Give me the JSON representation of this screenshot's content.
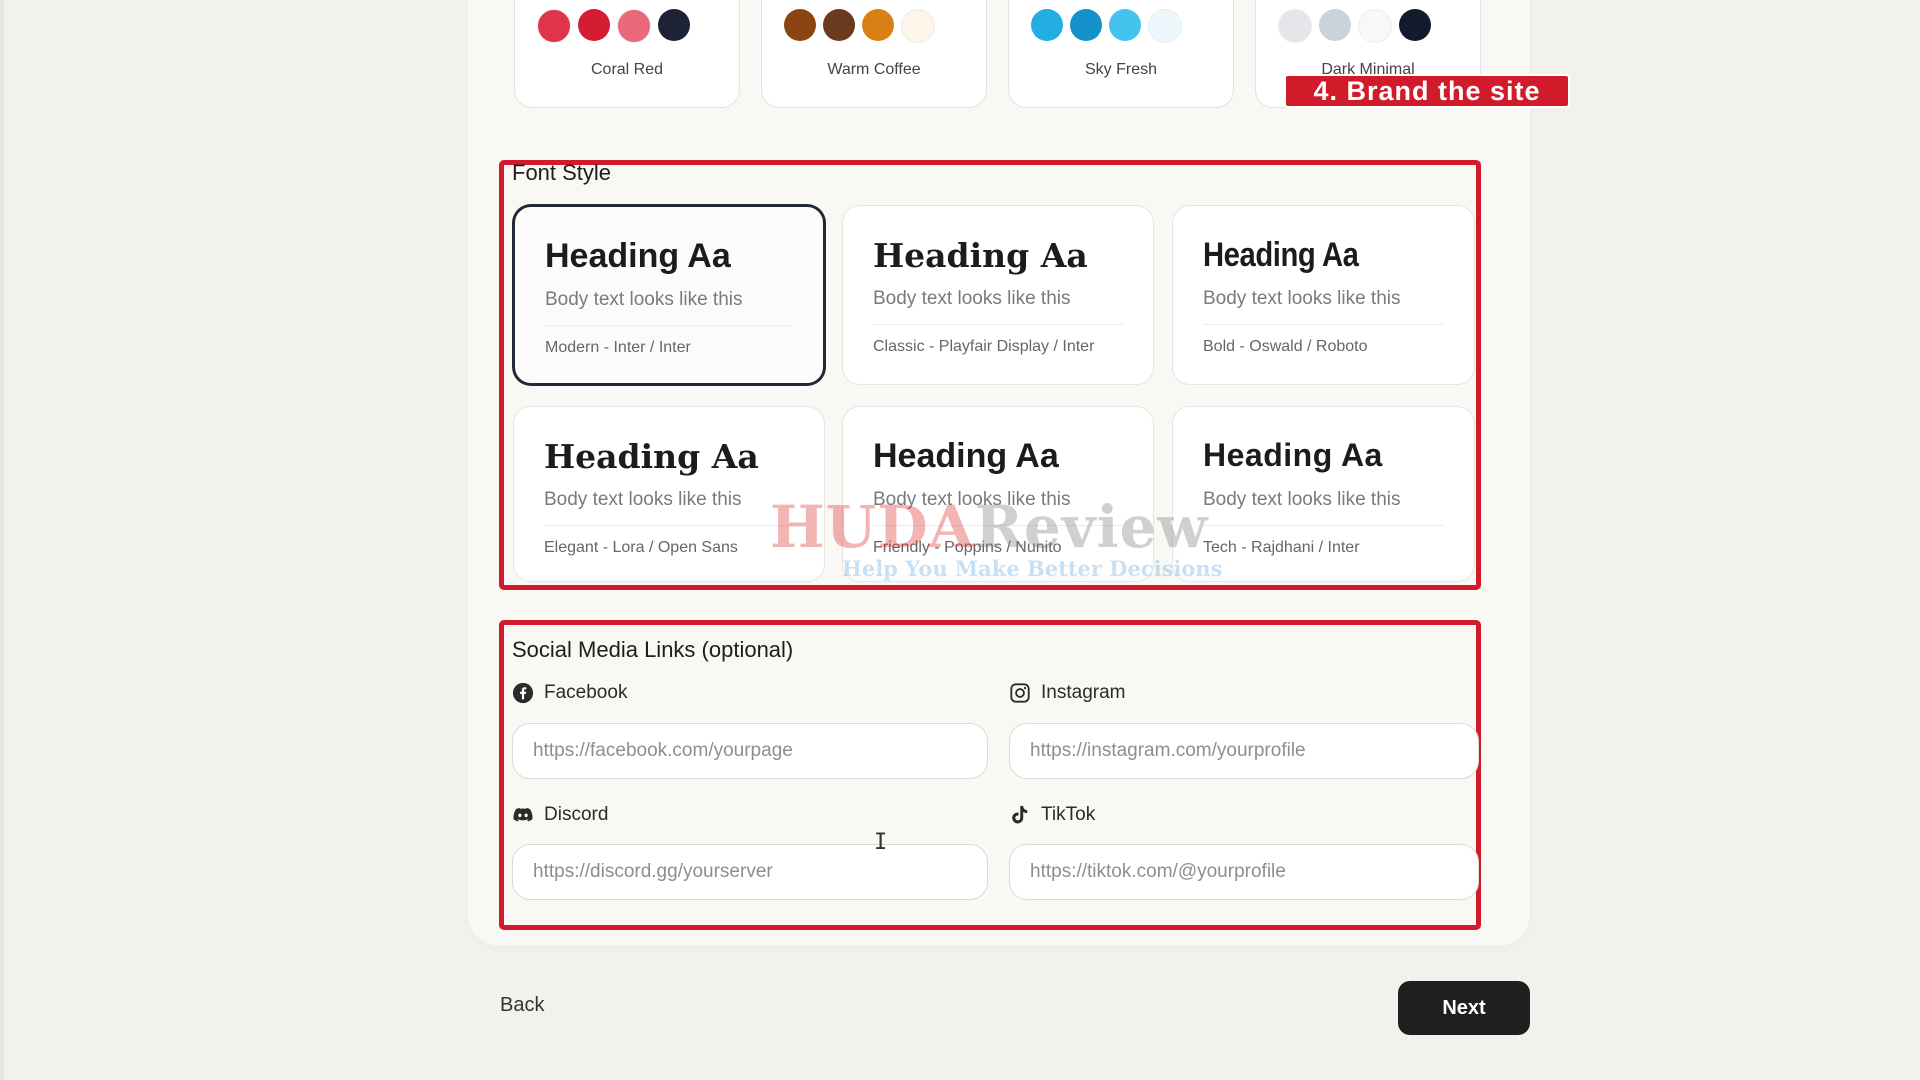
{
  "themes": [
    {
      "name": "Coral Red",
      "colors": [
        "#e0344a",
        "#d41c33",
        "#ea6878",
        "#1e2235"
      ]
    },
    {
      "name": "Warm Coffee",
      "colors": [
        "#8b4513",
        "#6b3a1e",
        "#d98015",
        "#fbf6e9"
      ]
    },
    {
      "name": "Sky Fresh",
      "colors": [
        "#22aee3",
        "#1391c8",
        "#44c3ee",
        "#eef7fc"
      ]
    },
    {
      "name": "Dark Minimal",
      "colors": [
        "#e4e6ea",
        "#ccd2da",
        "#f7f8fa",
        "#141a2b"
      ]
    }
  ],
  "step_badge": "4. Brand the site",
  "font_style": {
    "title": "Font Style",
    "options": [
      {
        "heading": "Heading Aa",
        "body": "Body text looks like this",
        "meta": "Modern - Inter / Inter",
        "selected": true
      },
      {
        "heading": "Heading Aa",
        "body": "Body text looks like this",
        "meta": "Classic - Playfair Display / Inter",
        "selected": false
      },
      {
        "heading": "Heading Aa",
        "body": "Body text looks like this",
        "meta": "Bold - Oswald / Roboto",
        "selected": false
      },
      {
        "heading": "Heading Aa",
        "body": "Body text looks like this",
        "meta": "Elegant - Lora / Open Sans",
        "selected": false
      },
      {
        "heading": "Heading Aa",
        "body": "Body text looks like this",
        "meta": "Friendly - Poppins / Nunito",
        "selected": false
      },
      {
        "heading": "Heading Aa",
        "body": "Body text looks like this",
        "meta": "Tech - Rajdhani / Inter",
        "selected": false
      }
    ]
  },
  "social": {
    "title": "Social Media Links (optional)",
    "fields": [
      {
        "label": "Facebook",
        "icon": "facebook-icon",
        "placeholder": "https://facebook.com/yourpage",
        "value": ""
      },
      {
        "label": "Instagram",
        "icon": "instagram-icon",
        "placeholder": "https://instagram.com/yourprofile",
        "value": ""
      },
      {
        "label": "Discord",
        "icon": "discord-icon",
        "placeholder": "https://discord.gg/yourserver",
        "value": ""
      },
      {
        "label": "TikTok",
        "icon": "tiktok-icon",
        "placeholder": "https://tiktok.com/@yourprofile",
        "value": ""
      }
    ]
  },
  "nav": {
    "back_label": "Back",
    "next_label": "Next"
  },
  "watermark": {
    "brand_a": "HUDA",
    "brand_b": "Review",
    "tagline": "Help You Make Better Decisions"
  },
  "accent_color": "#d11a2a"
}
